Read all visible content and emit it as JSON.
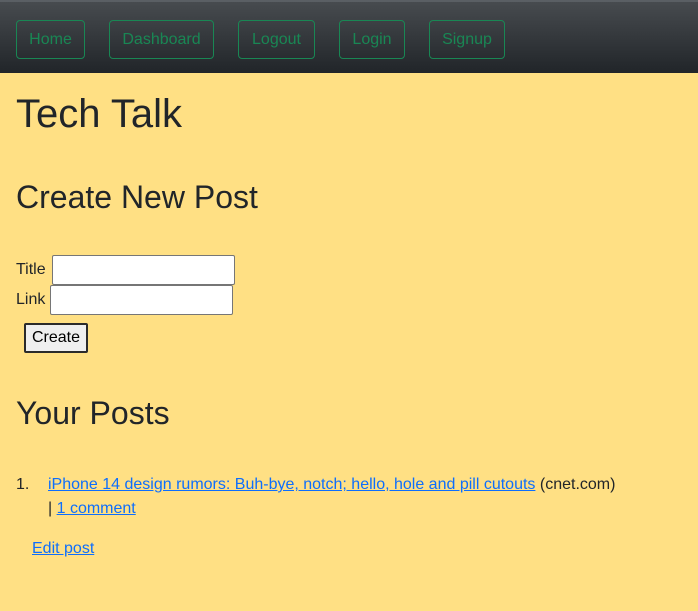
{
  "nav": {
    "home": "Home",
    "dashboard": "Dashboard",
    "logout": "Logout",
    "login": "Login",
    "signup": "Signup"
  },
  "site_title": "Tech Talk",
  "create": {
    "heading": "Create New Post",
    "title_label": "Title",
    "title_value": "",
    "link_label": "Link",
    "link_value": "",
    "submit_label": "Create"
  },
  "posts": {
    "heading": "Your Posts",
    "items": [
      {
        "number": "1.",
        "title": "iPhone 14 design rumors: Buh-bye, notch; hello, hole and pill cutouts",
        "domain": "(cnet.com)",
        "separator": "|",
        "comments": "1 comment",
        "edit": "Edit post"
      }
    ]
  },
  "colors": {
    "background": "#ffe084",
    "nav_accent": "#198754",
    "link": "#0d6efd"
  }
}
